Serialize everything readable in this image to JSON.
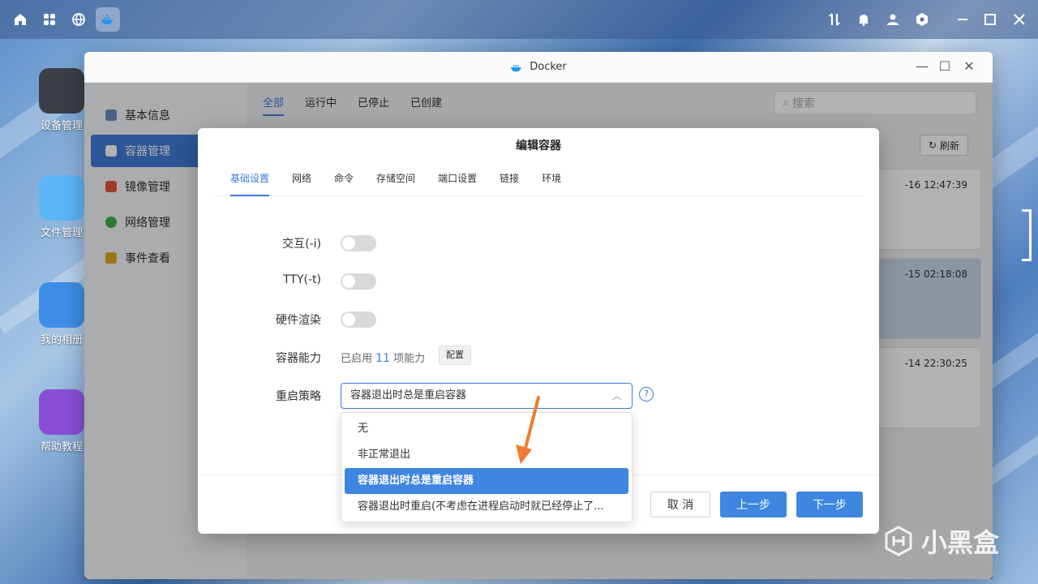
{
  "desktop": {
    "icons": [
      {
        "label": "设备管理",
        "color": "#3a3f47"
      },
      {
        "label": "文件管理",
        "color": "#3aa0f0"
      },
      {
        "label": "我的相册",
        "color": "#3e8ee8"
      },
      {
        "label": "帮助教程",
        "color": "#8a4fd6"
      }
    ]
  },
  "window": {
    "title": "Docker",
    "sidebar": [
      {
        "label": "基本信息",
        "color": "#6a8bbf"
      },
      {
        "label": "容器管理",
        "color": "#ffffff"
      },
      {
        "label": "镜像管理",
        "color": "#e0573c"
      },
      {
        "label": "网络管理",
        "color": "#3bb04a"
      },
      {
        "label": "事件查看",
        "color": "#e0a92a"
      }
    ],
    "top_tabs": [
      "全部",
      "运行中",
      "已停止",
      "已创建"
    ],
    "search_placeholder": "搜索",
    "refresh_label": "刷新",
    "card_times": [
      "-16 12:47:39",
      "-15 02:18:08",
      "-14 22:30:25"
    ]
  },
  "modal": {
    "title": "编辑容器",
    "tabs": [
      "基础设置",
      "网络",
      "命令",
      "存储空间",
      "端口设置",
      "链接",
      "环境"
    ],
    "fields": {
      "interactive_label": "交互(-i)",
      "tty_label": "TTY(-t)",
      "hw_render_label": "硬件渲染",
      "capability_label": "容器能力",
      "capability_prefix": "已启用",
      "capability_count": "11",
      "capability_suffix": "项能力",
      "capability_button": "配置",
      "restart_label": "重启策略",
      "restart_value": "容器退出时总是重启容器",
      "help_glyph": "?"
    },
    "buttons": {
      "cancel": "取 消",
      "prev": "上一步",
      "next": "下一步"
    }
  },
  "dropdown": {
    "options": [
      "无",
      "非正常退出",
      "容器退出时总是重启容器",
      "容器退出时重启(不考虑在进程启动时就已经停止了..."
    ],
    "selected_index": 2
  },
  "watermark": {
    "text": "小黑盒"
  },
  "colors": {
    "accent": "#3f86e0",
    "annotation": "#f07b2e"
  }
}
